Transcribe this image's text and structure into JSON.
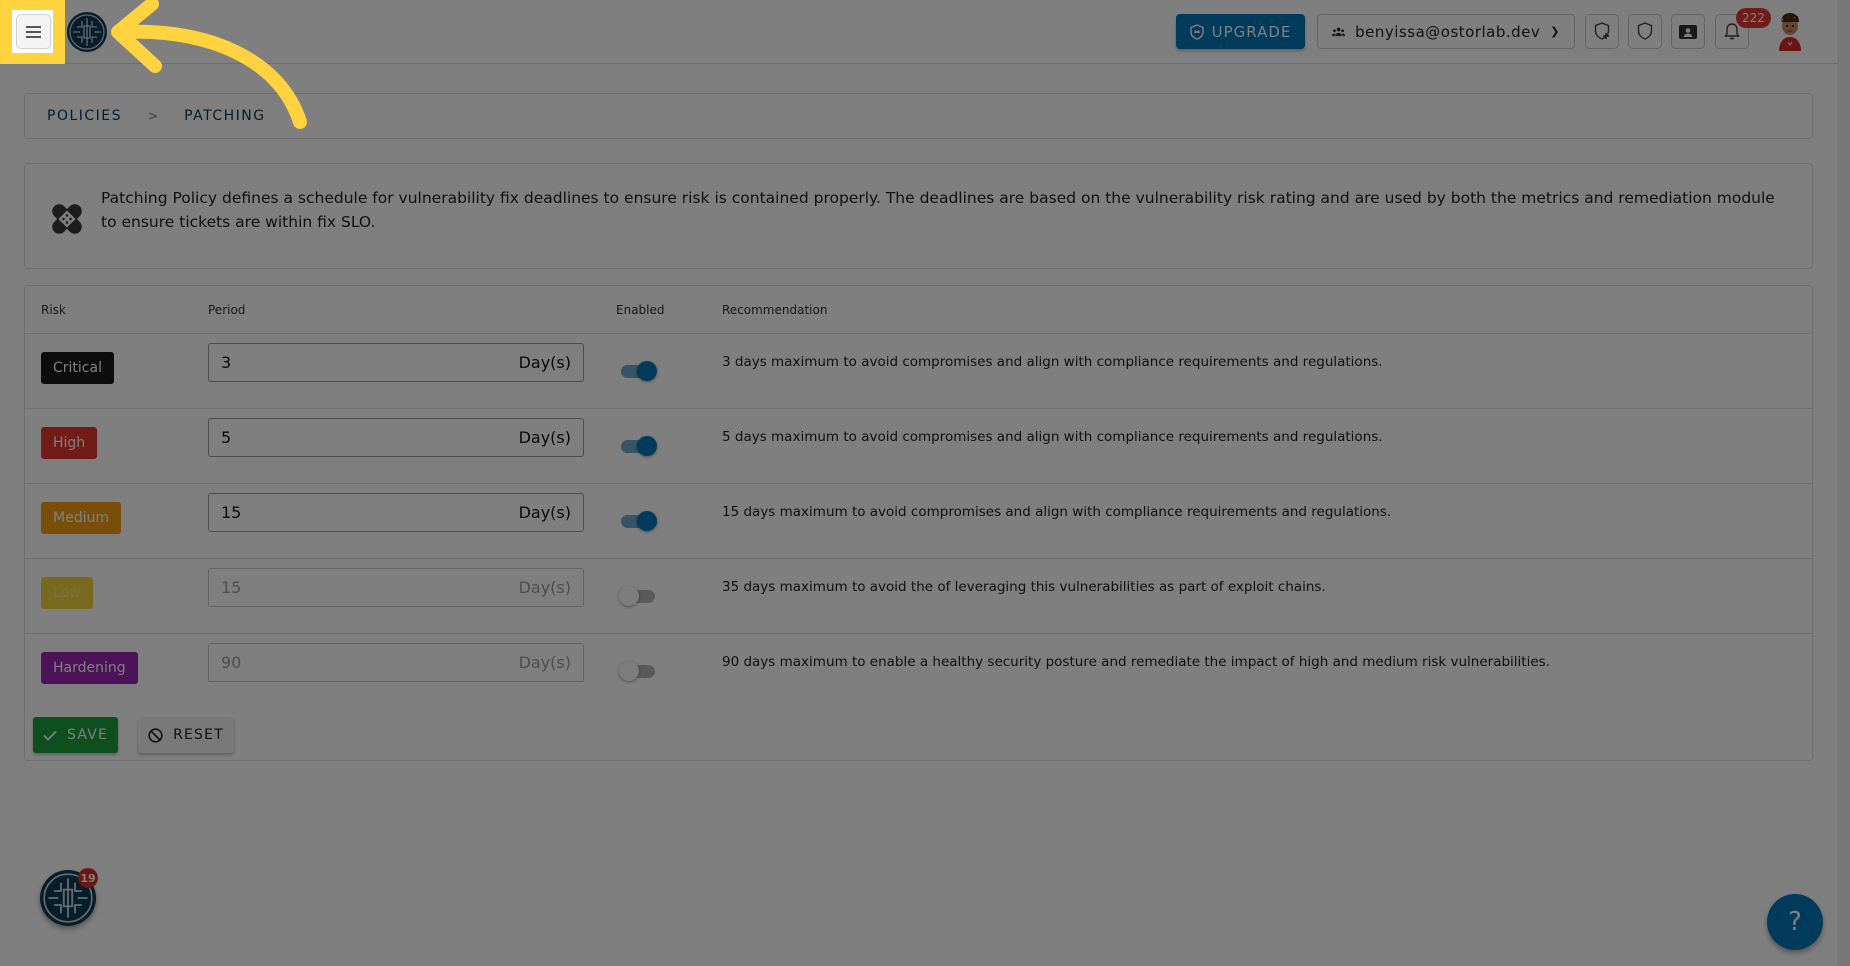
{
  "topbar": {
    "menu_icon": "hamburger-menu-icon",
    "logo": "ostorlab-logo",
    "upgrade_label": "UPGRADE",
    "upgrade_icon": "crown-shield-icon",
    "account": {
      "icon": "users-icon",
      "email": "benyissa@ostorlab.dev",
      "chevron": "chevron-down-icon"
    },
    "icon_buttons": [
      {
        "name": "shield-plus-icon"
      },
      {
        "name": "shield-icon"
      },
      {
        "name": "contact-card-icon"
      },
      {
        "name": "bell-icon"
      }
    ],
    "notification_count": "222",
    "avatar": "user-avatar"
  },
  "breadcrumb": {
    "items": [
      "POLICIES",
      "PATCHING"
    ],
    "separator": ">"
  },
  "info": {
    "icon": "bandage-icon",
    "text": "Patching Policy defines a schedule for vulnerability fix deadlines to ensure risk is contained properly. The deadlines are based on the vulnerability risk rating and are used by both the metrics and remediation module to ensure tickets are within fix SLO."
  },
  "table": {
    "headers": {
      "risk": "Risk",
      "period": "Period",
      "enabled": "Enabled",
      "recommendation": "Recommendation"
    },
    "unit": "Day(s)",
    "rows": [
      {
        "risk": "Critical",
        "color": "#1a1a1a",
        "period": "3",
        "enabled": true,
        "recommendation": "3 days maximum to avoid compromises and align with compliance requirements and regulations."
      },
      {
        "risk": "High",
        "color": "#e53935",
        "period": "5",
        "enabled": true,
        "recommendation": "5 days maximum to avoid compromises and align with compliance requirements and regulations."
      },
      {
        "risk": "Medium",
        "color": "#f39c12",
        "period": "15",
        "enabled": true,
        "recommendation": "15 days maximum to avoid compromises and align with compliance requirements and regulations."
      },
      {
        "risk": "Low",
        "color": "#f1d23f",
        "period": "15",
        "enabled": false,
        "recommendation": "35 days maximum to avoid the of leveraging this vulnerabilities as part of exploit chains."
      },
      {
        "risk": "Hardening",
        "color": "#9b27b0",
        "period": "90",
        "enabled": false,
        "recommendation": "90 days maximum to enable a healthy security posture and remediate the impact of high and medium risk vulnerabilities."
      }
    ]
  },
  "actions": {
    "save_label": "SAVE",
    "save_icon": "check-icon",
    "reset_label": "RESET",
    "reset_icon": "block-icon"
  },
  "floating": {
    "assistant_badge": "19",
    "help_label": "?"
  },
  "colors": {
    "primary": "#0077b6",
    "success": "#1b9e3e",
    "highlight": "#ffd23f",
    "brand_dark": "#0c3a56"
  }
}
